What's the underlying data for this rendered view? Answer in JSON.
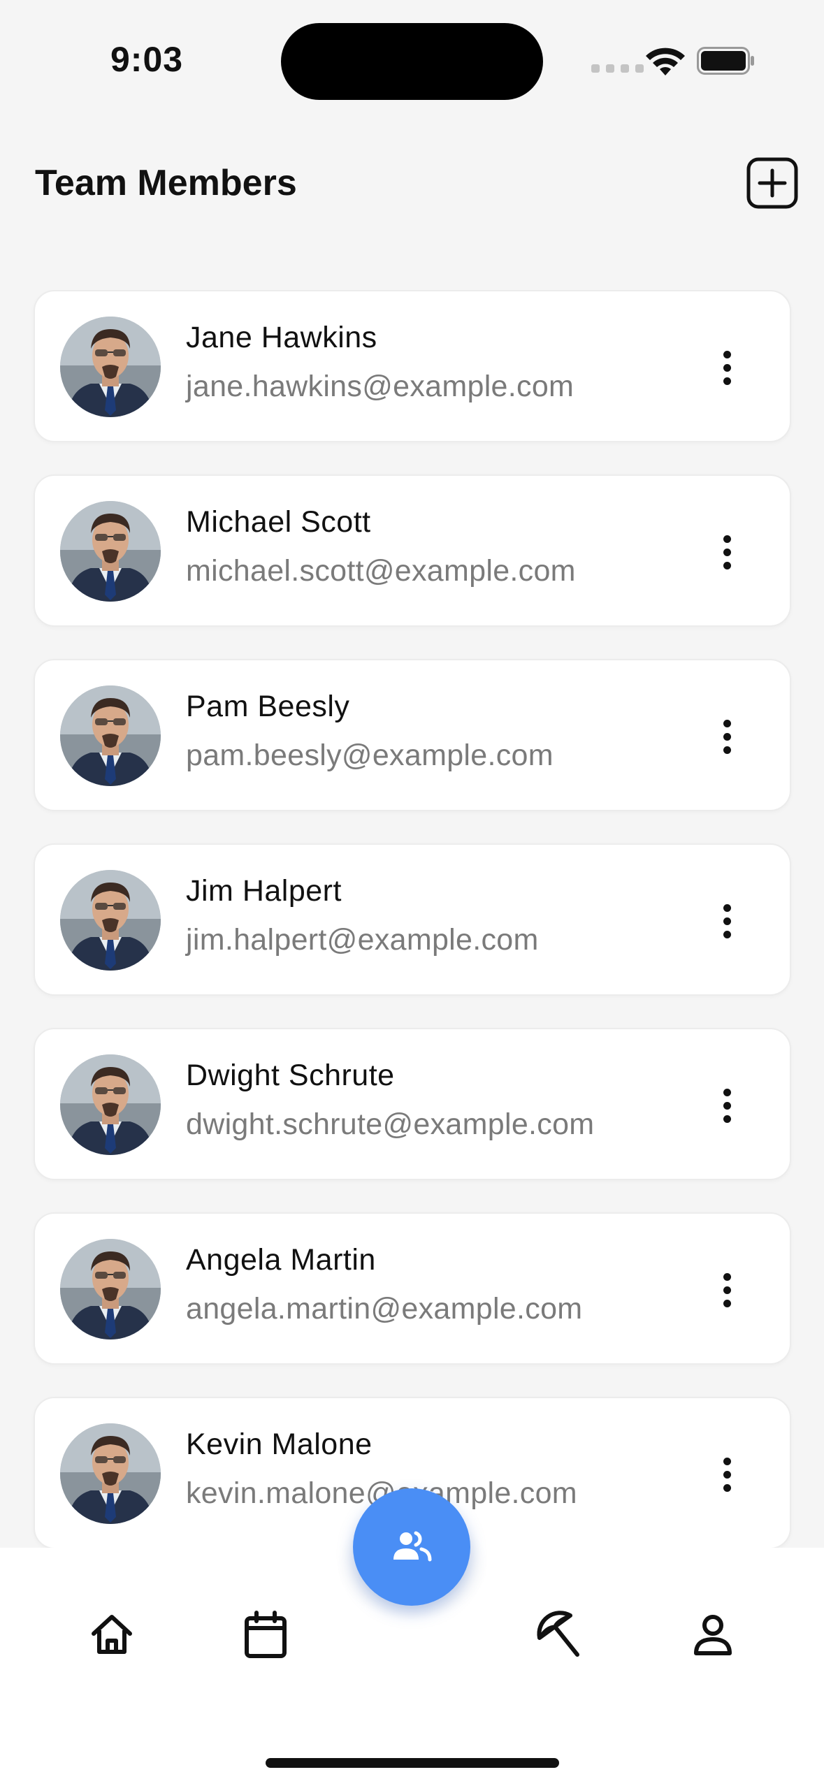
{
  "status_bar": {
    "time": "9:03"
  },
  "header": {
    "title": "Team Members"
  },
  "members": [
    {
      "name": "Jane Hawkins",
      "email": "jane.hawkins@example.com"
    },
    {
      "name": "Michael Scott",
      "email": "michael.scott@example.com"
    },
    {
      "name": "Pam Beesly",
      "email": "pam.beesly@example.com"
    },
    {
      "name": "Jim Halpert",
      "email": "jim.halpert@example.com"
    },
    {
      "name": "Dwight Schrute",
      "email": "dwight.schrute@example.com"
    },
    {
      "name": "Angela Martin",
      "email": "angela.martin@example.com"
    },
    {
      "name": "Kevin Malone",
      "email": "kevin.malone@example.com"
    }
  ],
  "bottom_nav": {
    "items": [
      "home-icon",
      "calendar-icon",
      "team-icon",
      "beach-umbrella-icon",
      "profile-icon"
    ],
    "active": "team-icon"
  },
  "colors": {
    "accent": "#4a8ef5",
    "background": "#f5f5f5",
    "card": "#ffffff",
    "secondary_text": "#7a7a7a"
  }
}
